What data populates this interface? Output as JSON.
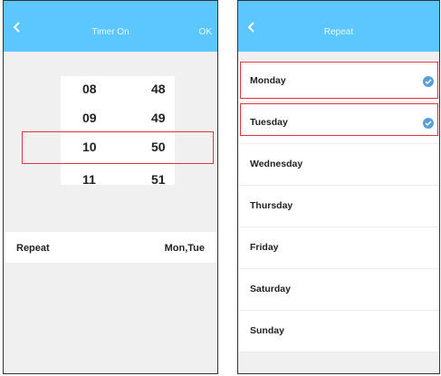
{
  "timer_screen": {
    "title": "Timer On",
    "ok_label": "OK",
    "picker": {
      "hours": [
        "08",
        "09",
        "10",
        "11"
      ],
      "minutes": [
        "48",
        "49",
        "50",
        "51"
      ],
      "selected_hour": "10",
      "selected_minute": "50"
    },
    "repeat_label": "Repeat",
    "repeat_value": "Mon,Tue"
  },
  "repeat_screen": {
    "title": "Repeat",
    "days": [
      {
        "label": "Monday",
        "checked": true
      },
      {
        "label": "Tuesday",
        "checked": true
      },
      {
        "label": "Wednesday",
        "checked": false
      },
      {
        "label": "Thursday",
        "checked": false
      },
      {
        "label": "Friday",
        "checked": false
      },
      {
        "label": "Saturday",
        "checked": false
      },
      {
        "label": "Sunday",
        "checked": false
      }
    ]
  },
  "colors": {
    "header": "#5cc6ff",
    "highlight": "#e0353f",
    "check": "#5b9fd6"
  },
  "icons": {
    "back": "chevron-left-icon",
    "check": "check-circle-icon"
  }
}
